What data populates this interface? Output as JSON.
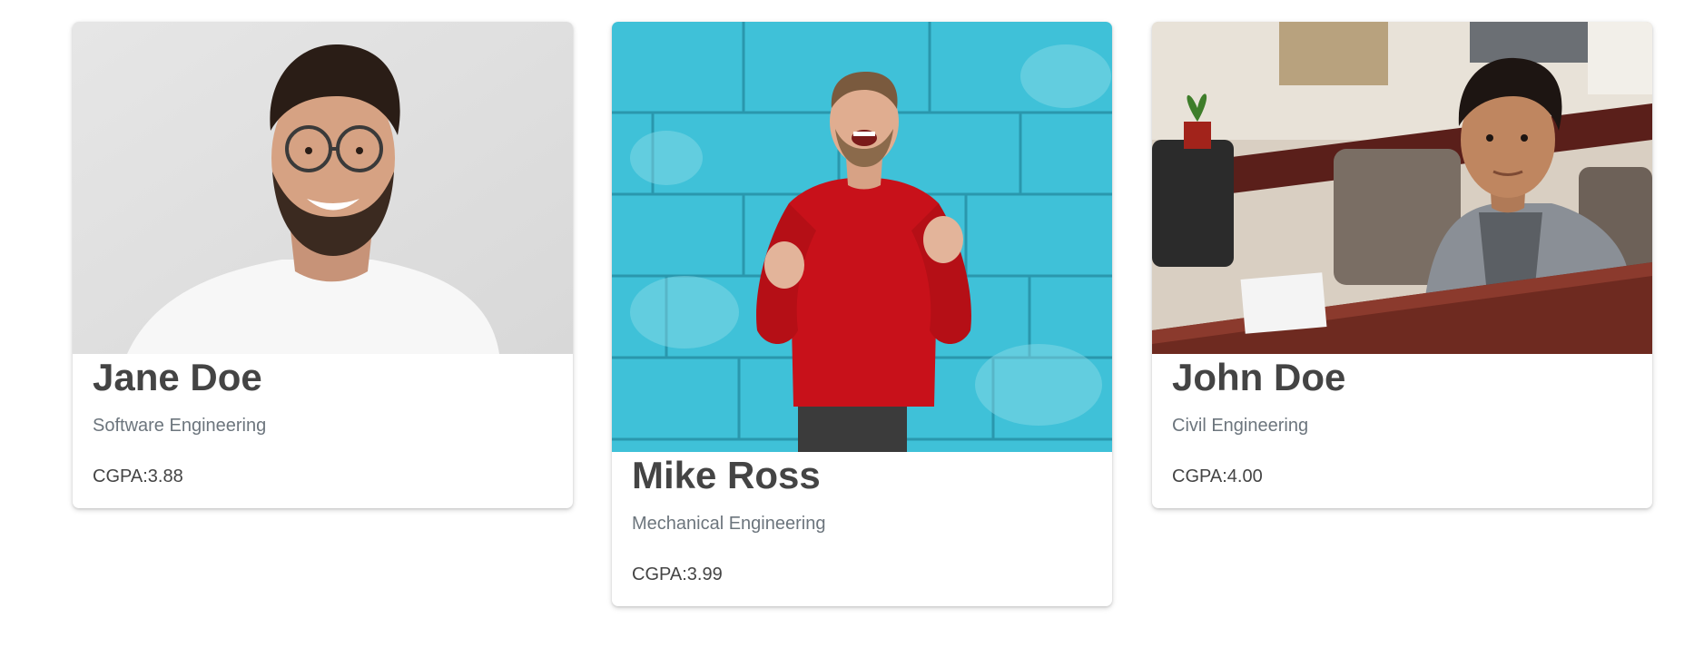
{
  "students": [
    {
      "name": "Jane Doe",
      "major": "Software Engineering",
      "cgpa_label": "CGPA:",
      "cgpa_value": "3.88",
      "photo_alt": "Smiling man with round glasses in white t-shirt"
    },
    {
      "name": "Mike Ross",
      "major": "Mechanical Engineering",
      "cgpa_label": "CGPA:",
      "cgpa_value": "3.99",
      "photo_alt": "Man in red sweater celebrating in front of blue brick wall"
    },
    {
      "name": "John Doe",
      "major": "Civil Engineering",
      "cgpa_label": "CGPA:",
      "cgpa_value": "4.00",
      "photo_alt": "Young man in grey cardigan at an office desk"
    }
  ],
  "colors": {
    "name_text": "#444444",
    "major_text": "#6c757d",
    "card_bg": "#ffffff"
  }
}
